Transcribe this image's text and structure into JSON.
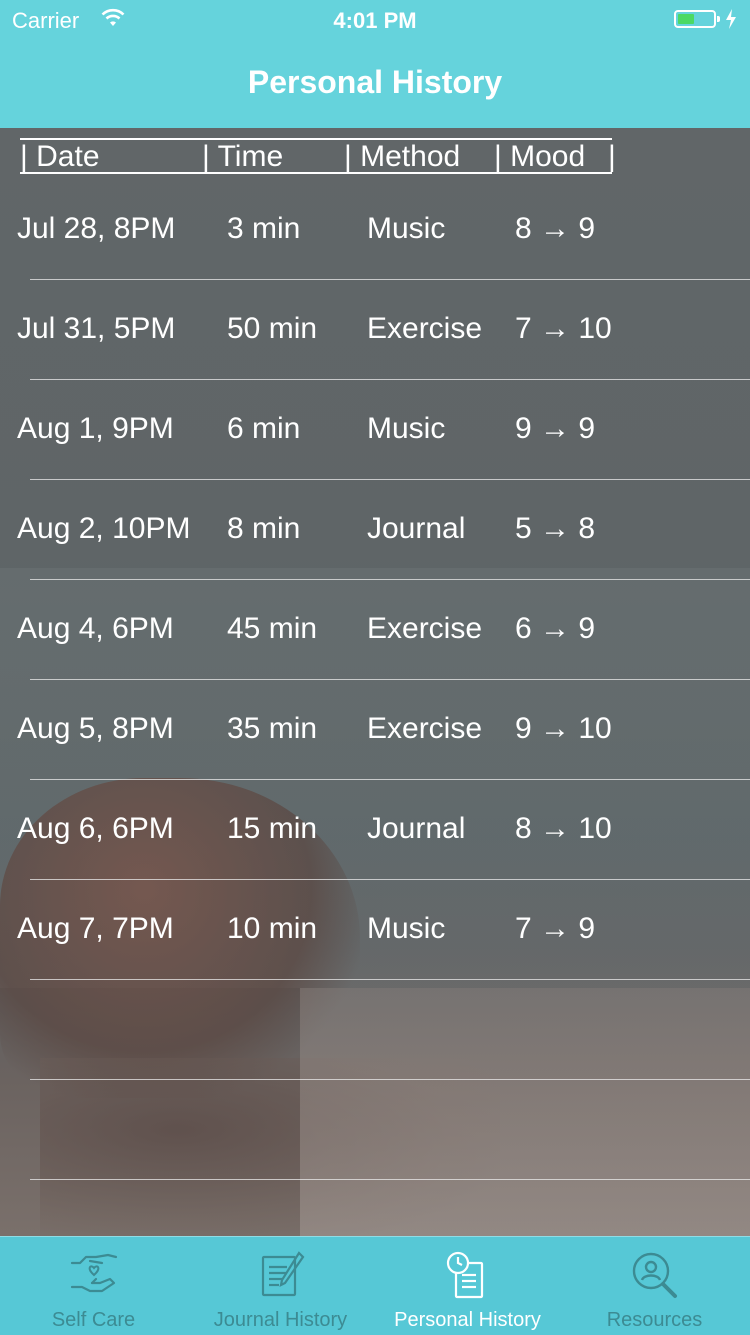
{
  "status_bar": {
    "carrier": "Carrier",
    "time": "4:01 PM"
  },
  "nav": {
    "title": "Personal History"
  },
  "table": {
    "headers": {
      "date": "| Date",
      "time": "| Time",
      "method": "| Method",
      "mood": "| Mood",
      "end": "|"
    },
    "rows": [
      {
        "date": "Jul 28, 8PM",
        "time": "3 min",
        "method": "Music",
        "mood": "8 → 9"
      },
      {
        "date": "Jul 31, 5PM",
        "time": "50 min",
        "method": "Exercise",
        "mood": "7 → 10"
      },
      {
        "date": "Aug 1, 9PM",
        "time": "6 min",
        "method": "Music",
        "mood": "9 → 9"
      },
      {
        "date": "Aug 2, 10PM",
        "time": "8 min",
        "method": "Journal",
        "mood": "5 → 8"
      },
      {
        "date": "Aug 4, 6PM",
        "time": "45 min",
        "method": "Exercise",
        "mood": "6 → 9"
      },
      {
        "date": "Aug 5, 8PM",
        "time": "35 min",
        "method": "Exercise",
        "mood": "9 → 10"
      },
      {
        "date": "Aug 6, 6PM",
        "time": "15 min",
        "method": "Journal",
        "mood": "8 → 10"
      },
      {
        "date": "Aug 7, 7PM",
        "time": "10 min",
        "method": "Music",
        "mood": "7 → 9"
      },
      {
        "date": "",
        "time": "",
        "method": "",
        "mood": ""
      },
      {
        "date": "",
        "time": "",
        "method": "",
        "mood": ""
      }
    ]
  },
  "tabbar": {
    "tabs": [
      {
        "label": "Self Care",
        "icon": "hand-heart-icon",
        "active": false
      },
      {
        "label": "Journal History",
        "icon": "notebook-pen-icon",
        "active": false
      },
      {
        "label": "Personal History",
        "icon": "clock-document-icon",
        "active": true
      },
      {
        "label": "Resources",
        "icon": "person-search-icon",
        "active": false
      }
    ]
  },
  "colors": {
    "nav_background": "#65d3dc",
    "tabbar_background": "#56c8d6",
    "tab_inactive": "#3c8b93",
    "tab_active": "#ffffff",
    "battery_fill": "#4cd964"
  }
}
